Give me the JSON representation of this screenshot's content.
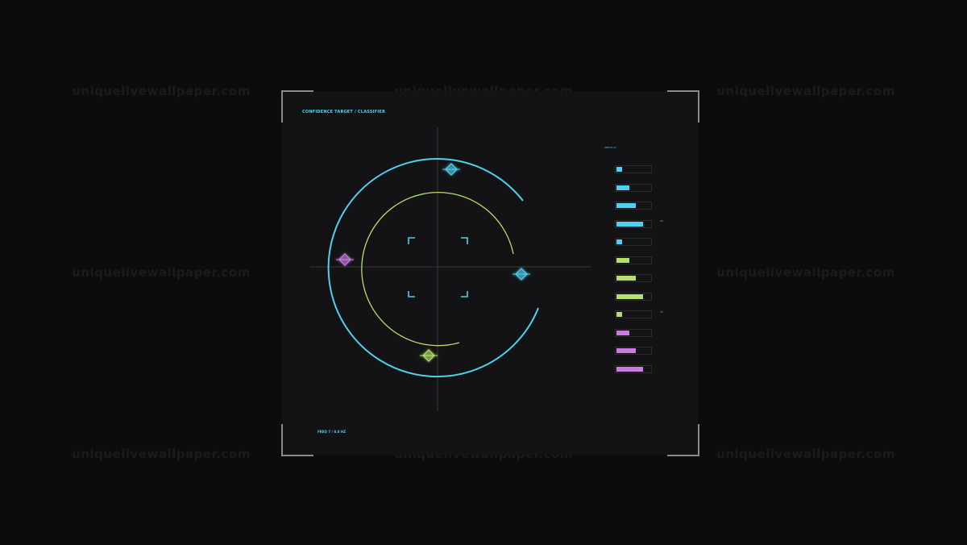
{
  "watermark": {
    "text": "uniquelivewallpaper.com"
  },
  "panel": {
    "title": "CONFIDENCE TARGET / CLASSIFIER",
    "footer": "FREQ 7 / 8.0 HZ",
    "bars_label": "DEPTH 01",
    "tick_labels": [
      "25",
      "75"
    ]
  },
  "colors": {
    "cyan": "#4fd0ee",
    "lime": "#b4e06a",
    "magenta": "#c97be0",
    "amber": "#d4b44a",
    "frame": "#8a8a8c"
  },
  "markers": [
    {
      "name": "marker-top",
      "color": "cyan"
    },
    {
      "name": "marker-left",
      "color": "magenta"
    },
    {
      "name": "marker-right",
      "color": "cyan"
    },
    {
      "name": "marker-bottom",
      "color": "lime"
    }
  ],
  "bars": [
    {
      "color": "cyan",
      "level": 0.16
    },
    {
      "color": "cyan",
      "level": 0.36
    },
    {
      "color": "cyan",
      "level": 0.55
    },
    {
      "color": "cyan",
      "level": 0.75
    },
    {
      "color": "cyan",
      "level": 0.16
    },
    {
      "color": "lime",
      "level": 0.36
    },
    {
      "color": "lime",
      "level": 0.55
    },
    {
      "color": "lime",
      "level": 0.75
    },
    {
      "color": "lime",
      "level": 0.16
    },
    {
      "color": "magenta",
      "level": 0.36
    },
    {
      "color": "magenta",
      "level": 0.55
    },
    {
      "color": "magenta",
      "level": 0.75
    }
  ]
}
